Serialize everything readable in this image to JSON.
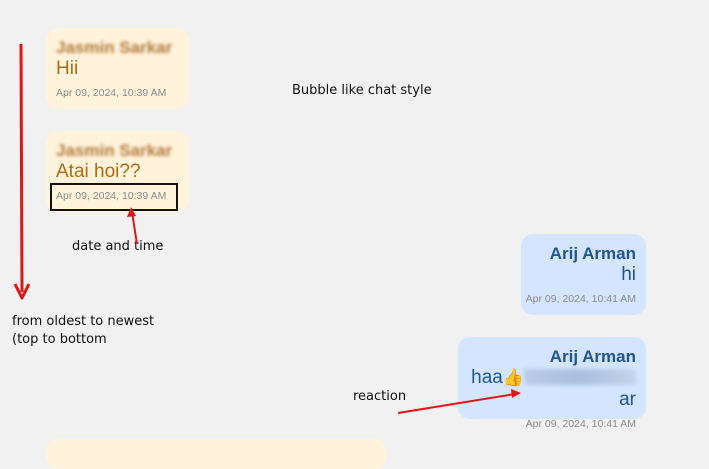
{
  "messages": [
    {
      "side": "left",
      "sender": "Jasmin Sarkar",
      "text": "Hii",
      "time": "Apr 09, 2024, 10:39 AM"
    },
    {
      "side": "left",
      "sender": "Jasmin Sarkar",
      "text": "Atai hoi??",
      "time": "Apr 09, 2024, 10:39 AM"
    },
    {
      "side": "right",
      "sender": "Arij Arman",
      "text": "hi",
      "time": "Apr 09, 2024, 10:41 AM"
    },
    {
      "side": "right",
      "sender": "Arij Arman",
      "text": "haa",
      "reaction": "👍",
      "reaction_tail": "ar",
      "time": "Apr 09, 2024, 10:41 AM"
    }
  ],
  "annotations": {
    "chat_style": "Bubble like chat style",
    "date_time": "date and time",
    "order_line1": "from oldest to newest",
    "order_line2": "(top to bottom",
    "reaction": "reaction"
  },
  "colors": {
    "incoming_bubble": "#fff3dc",
    "outgoing_bubble": "#d4e6ff",
    "annotation_red": "#e01515"
  }
}
